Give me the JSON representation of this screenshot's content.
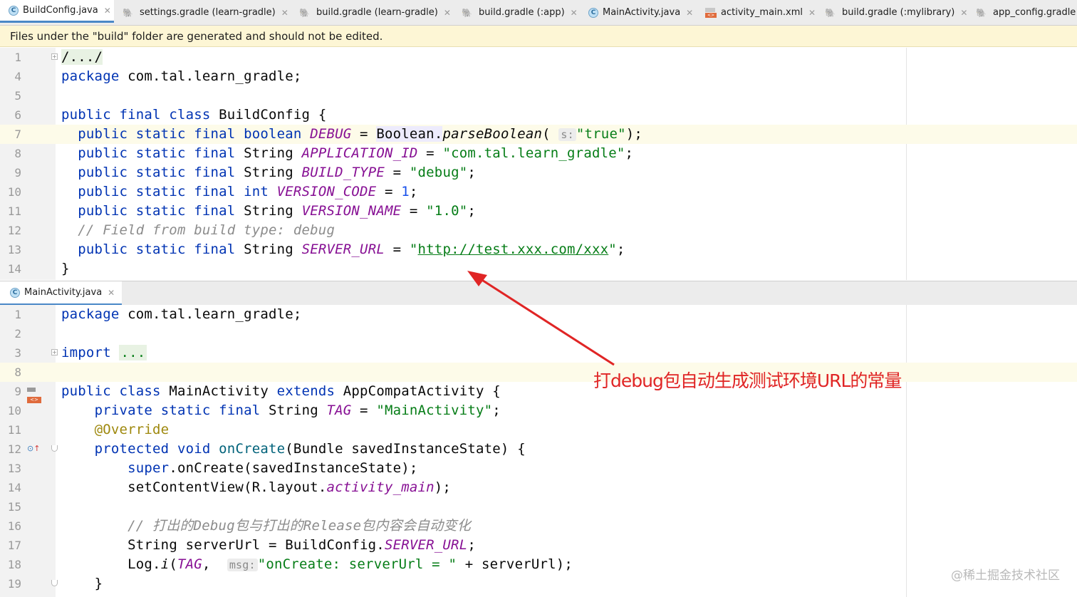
{
  "tabs": [
    {
      "label": "BuildConfig.java",
      "icon": "java-class-icon",
      "active": true
    },
    {
      "label": "settings.gradle (learn-gradle)",
      "icon": "gradle-icon"
    },
    {
      "label": "build.gradle (learn-gradle)",
      "icon": "gradle-icon"
    },
    {
      "label": "build.gradle (:app)",
      "icon": "gradle-icon"
    },
    {
      "label": "MainActivity.java",
      "icon": "java-class-icon"
    },
    {
      "label": "activity_main.xml",
      "icon": "xml-layout-icon"
    },
    {
      "label": "build.gradle (:mylibrary)",
      "icon": "gradle-icon"
    },
    {
      "label": "app_config.gradle",
      "icon": "gradle-icon"
    }
  ],
  "banner": {
    "text": "Files under the \"build\" folder are generated and should not be edited."
  },
  "editor1": {
    "line_numbers": [
      "1",
      "4",
      "5",
      "6",
      "7",
      "8",
      "9",
      "10",
      "11",
      "12",
      "13",
      "14"
    ],
    "text": {
      "l1": "/.../",
      "l4": "package com.tal.learn_gradle;",
      "public": "public",
      "static": "static",
      "final": "final",
      "class": "class",
      "class_name": "BuildConfig {",
      "boolean": "boolean",
      "debug_const": "DEBUG",
      "boolean_cls": "Boolean.",
      "parse": "parseBoolean",
      "s_hint": "s:",
      "true_str": "\"true\"",
      "string": "String",
      "app_id": "APPLICATION_ID",
      "app_id_val": "\"com.tal.learn_gradle\"",
      "build_type": "BUILD_TYPE",
      "build_type_val": "\"debug\"",
      "int": "int",
      "version_code": "VERSION_CODE",
      "version_code_val": "1",
      "version_name": "VERSION_NAME",
      "version_name_val": "\"1.0\"",
      "comment": "// Field from build type: debug",
      "server_url": "SERVER_URL",
      "server_url_val": "http://test.xxx.com/xxx",
      "close": "}"
    }
  },
  "editor2_tab": {
    "label": "MainActivity.java"
  },
  "editor2": {
    "line_numbers": [
      "1",
      "2",
      "3",
      "8",
      "9",
      "10",
      "11",
      "12",
      "13",
      "14",
      "15",
      "16",
      "17",
      "18",
      "19"
    ],
    "text": {
      "package": "package",
      "package_rest": " com.tal.learn_gradle;",
      "import": "import",
      "import_collapsed": "...",
      "public": "public",
      "class": "class",
      "main_activity": "MainActivity",
      "extends": "extends",
      "app_compat": "AppCompatActivity {",
      "private": "private",
      "static": "static",
      "final": "final",
      "string": "String",
      "tag": "TAG",
      "tag_val": "\"MainActivity\"",
      "override": "@Override",
      "protected": "protected",
      "void": "void",
      "on_create": "onCreate",
      "on_create_params": "(Bundle savedInstanceState) {",
      "super": "super",
      "super_call": ".onCreate(savedInstanceState);",
      "set_content": "setContentView(R.layout.",
      "activity_main": "activity_main",
      "set_content_end": ");",
      "comment_cn": "// 打出的Debug包与打出的Release包内容会自动变化",
      "server_decl": "String serverUrl = BuildConfig.",
      "server_const": "SERVER_URL",
      "semi": ";",
      "log": "Log.",
      "log_i": "i",
      "log_tag": "TAG",
      "msg_hint": "msg:",
      "log_str": "\"onCreate: serverUrl = \"",
      "log_rest": " + serverUrl);",
      "close": "}"
    }
  },
  "annotation": {
    "text": "打debug包自动生成测试环境URL的常量"
  },
  "watermark": {
    "text": "@稀土掘金技术社区"
  },
  "colors": {
    "keyword": "#0033b3",
    "string": "#067d17",
    "static_field": "#871094",
    "comment": "#8c8c8c",
    "annotation": "#9e880d",
    "arrow": "#e02525"
  }
}
